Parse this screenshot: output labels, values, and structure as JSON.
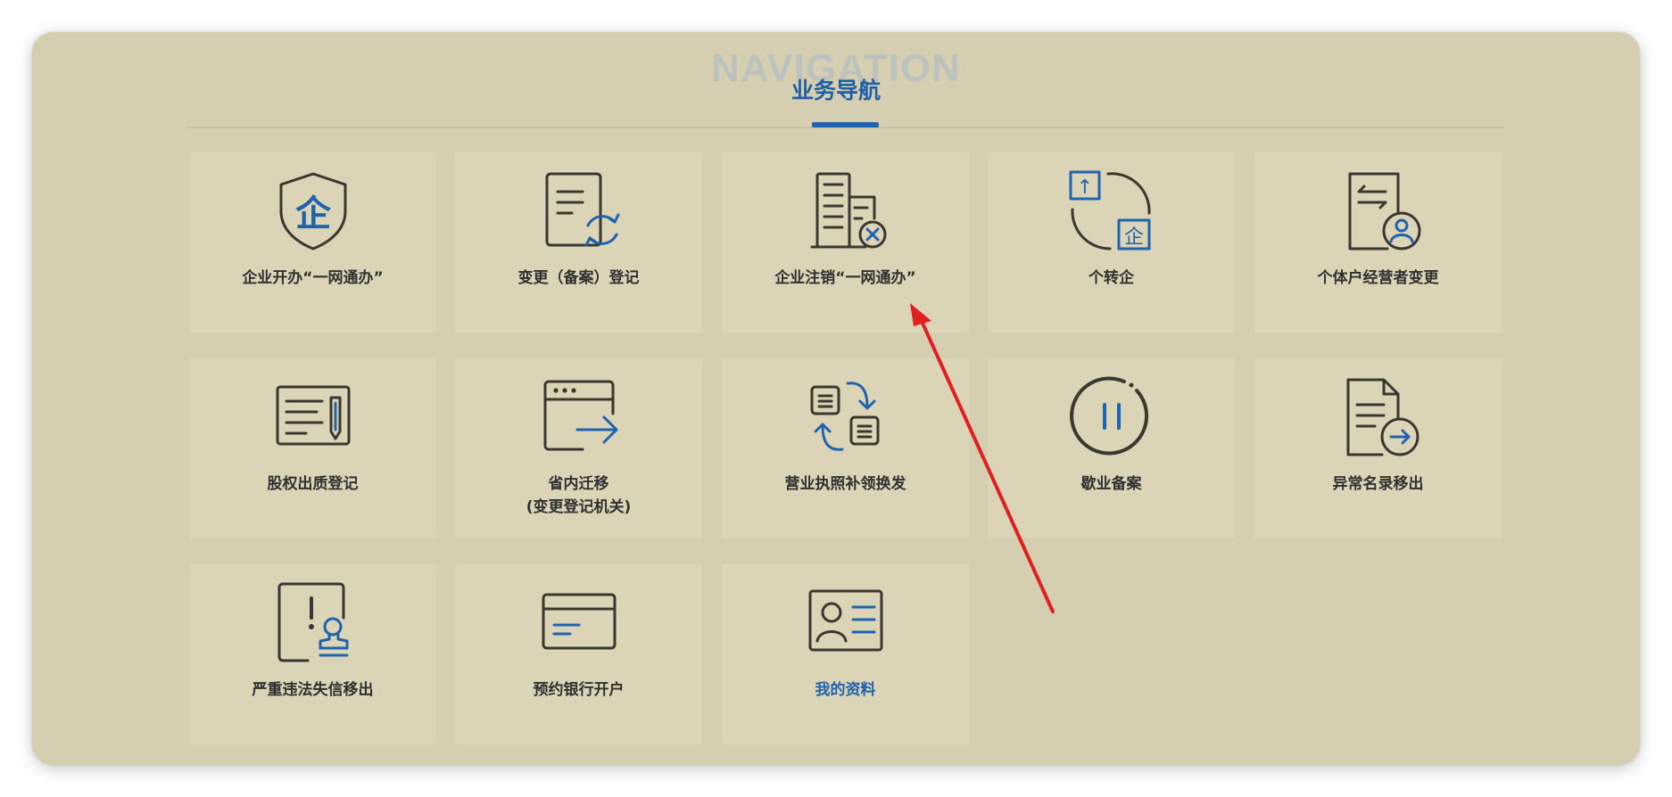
{
  "navigation": {
    "watermark": "NAVIGATION",
    "title": "业务导航"
  },
  "tiles": [
    {
      "label": "企业开办“一网通办”",
      "icon": "enterprise-shield-icon"
    },
    {
      "label": "变更（备案）登记",
      "icon": "document-refresh-icon"
    },
    {
      "label": "企业注销“一网通办”",
      "icon": "building-cancel-icon"
    },
    {
      "label": "个转企",
      "icon": "individual-to-enterprise-icon"
    },
    {
      "label": "个体户经营者变更",
      "icon": "document-person-exchange-icon"
    },
    {
      "label": "股权出质登记",
      "icon": "document-pen-icon"
    },
    {
      "label": "省内迁移",
      "label2": "(变更登记机关)",
      "icon": "window-arrow-icon"
    },
    {
      "label": "营业执照补领换发",
      "icon": "document-swap-icon"
    },
    {
      "label": "歇业备案",
      "icon": "pause-circle-icon"
    },
    {
      "label": "异常名录移出",
      "icon": "document-arrow-out-icon"
    },
    {
      "label": "严重违法失信移出",
      "icon": "warning-stamp-icon"
    },
    {
      "label": "预约银行开户",
      "icon": "bank-card-icon"
    },
    {
      "label": "我的资料",
      "icon": "id-card-icon",
      "active": true
    }
  ],
  "icon_glyphs": {
    "enterprise": "企",
    "upload_arrow": "↑"
  },
  "colors": {
    "panel": "#d6ceb0",
    "tile": "#dcd4b6",
    "accent_blue": "#1f62ad",
    "icon_dark": "#3a3630",
    "annotation_arrow": "#e02020"
  }
}
